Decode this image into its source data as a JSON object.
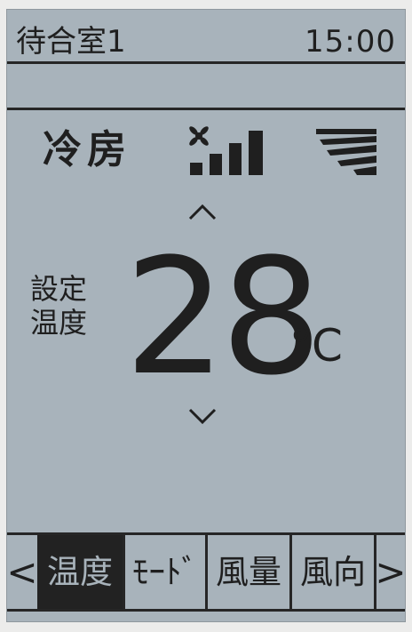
{
  "header": {
    "room_name": "待合室1",
    "time": "15:00"
  },
  "status": {
    "mode": "冷房",
    "fan_speed_icon": "fan-speed-bars-icon",
    "vane_icon": "airflow-vane-icon"
  },
  "setpoint": {
    "label": "設定温度",
    "value": "28",
    "unit": "°C",
    "up_icon": "chevron-up-icon",
    "down_icon": "chevron-down-icon"
  },
  "menu": {
    "prev": "<",
    "next": ">",
    "tabs": [
      {
        "label": "温度",
        "selected": true
      },
      {
        "label": "ﾓｰﾄﾞ",
        "selected": false
      },
      {
        "label": "風量",
        "selected": false
      },
      {
        "label": "風向",
        "selected": false
      }
    ]
  },
  "colors": {
    "lcd_background": "#a8b3bb",
    "lcd_ink": "#1f1f1f",
    "frame": "#ececeb"
  }
}
